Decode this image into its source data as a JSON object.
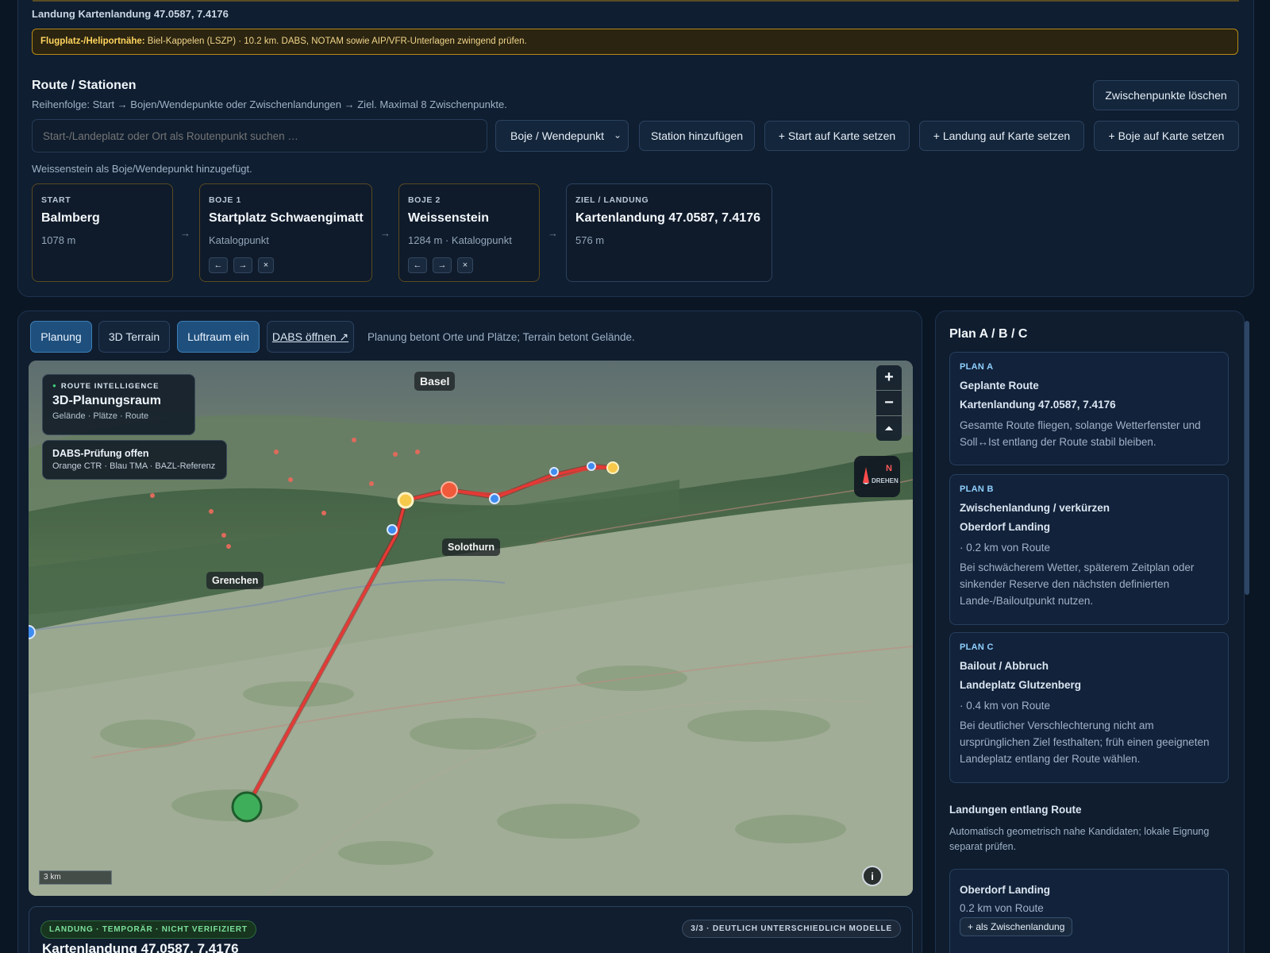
{
  "header": {
    "landing_line": "Landung Kartenlandung 47.0587, 7.4176",
    "warning_label": "Flugplatz-/Heliportnähe:",
    "warning_text": " Biel-Kappelen (LSZP) · 10.2 km. DABS, NOTAM sowie AIP/VFR-Unterlagen zwingend prüfen."
  },
  "route": {
    "title": "Route / Stationen",
    "subtitle": "Reihenfolge: Start → Bojen/Wendepunkte oder Zwischenlandungen → Ziel. Maximal 8 Zwischenpunkte.",
    "clear_button": "Zwischenpunkte löschen",
    "search_placeholder": "Start-/Landeplatz oder Ort als Routenpunkt suchen …",
    "type_select": "Boje / Wendepunkt",
    "add_station": "Station hinzufügen",
    "set_start": "+ Start auf Karte setzen",
    "set_landing": "+ Landung auf Karte setzen",
    "set_buoy": "+ Boje auf Karte setzen",
    "status": "Weissenstein als Boje/Wendepunkt hinzugefügt.",
    "stations": [
      {
        "kicker": "START",
        "name": "Balmberg",
        "meta": "1078 m"
      },
      {
        "kicker": "BOJE 1",
        "name": "Startplatz Schwaengimatt",
        "meta": "Katalogpunkt"
      },
      {
        "kicker": "BOJE 2",
        "name": "Weissenstein",
        "meta": "1284 m · Katalogpunkt"
      },
      {
        "kicker": "ZIEL / LANDUNG",
        "name": "Kartenlandung 47.0587, 7.4176",
        "meta": "576 m"
      }
    ],
    "arrow": "→",
    "ctrl_left": "←",
    "ctrl_right": "→",
    "ctrl_remove": "×"
  },
  "map_tabs": {
    "planning": "Planung",
    "terrain": "3D Terrain",
    "airspace": "Luftraum ein",
    "dabs": "DABS öffnen ↗",
    "note": "Planung betont Orte und Plätze; Terrain betont Gelände."
  },
  "map": {
    "overlay_kicker": "ROUTE INTELLIGENCE",
    "overlay_title": "3D-Planungsraum",
    "overlay_sub": "Gelände · Plätze · Route",
    "dabs_title": "DABS-Prüfung offen",
    "dabs_sub": "Orange CTR · Blau TMA · BAZL-Referenz",
    "places": {
      "basel": "Basel",
      "solothurn": "Solothurn",
      "grenchen": "Grenchen"
    },
    "zoom_in": "+",
    "zoom_out": "−",
    "tilt": "⏶",
    "compass_n": "N",
    "compass_label": "DREHEN",
    "scale": "3 km",
    "info": "i"
  },
  "bottom_card": {
    "badge_left": "LANDUNG · TEMPORÄR · NICHT VERIFIZIERT",
    "badge_right": "3/3 · DEUTLICH UNTERSCHIEDLICH MODELLE",
    "title": "Kartenlandung 47.0587, 7.4176"
  },
  "plans": {
    "title": "Plan A / B / C",
    "items": [
      {
        "kicker": "PLAN A",
        "heading": "Geplante Route",
        "target": "Kartenlandung 47.0587, 7.4176",
        "distance": "",
        "text": "Gesamte Route fliegen, solange Wetterfenster und Soll↔Ist entlang der Route stabil bleiben."
      },
      {
        "kicker": "PLAN B",
        "heading": "Zwischenlandung / verkürzen",
        "target": "Oberdorf Landing",
        "distance": "· 0.2 km von Route",
        "text": "Bei schwächerem Wetter, späterem Zeitplan oder sinkender Reserve den nächsten definierten Lande-/Bailoutpunkt nutzen."
      },
      {
        "kicker": "PLAN C",
        "heading": "Bailout / Abbruch",
        "target": "Landeplatz Glutzenberg",
        "distance": "· 0.4 km von Route",
        "text": "Bei deutlicher Verschlechterung nicht am ursprünglichen Ziel festhalten; früh einen geeigneten Landeplatz entlang der Route wählen."
      }
    ],
    "landings_title": "Landungen entlang Route",
    "landings_note": "Automatisch geometrisch nahe Kandidaten; lokale Eignung separat prüfen.",
    "landing_item": {
      "name": "Oberdorf Landing",
      "distance": "0.2 km von Route",
      "button": "+ als Zwischenlandung"
    }
  },
  "colors": {
    "route": "#e53935",
    "start": "#3fae5a",
    "accent": "#3d7fb7",
    "warning": "#b88a18"
  }
}
